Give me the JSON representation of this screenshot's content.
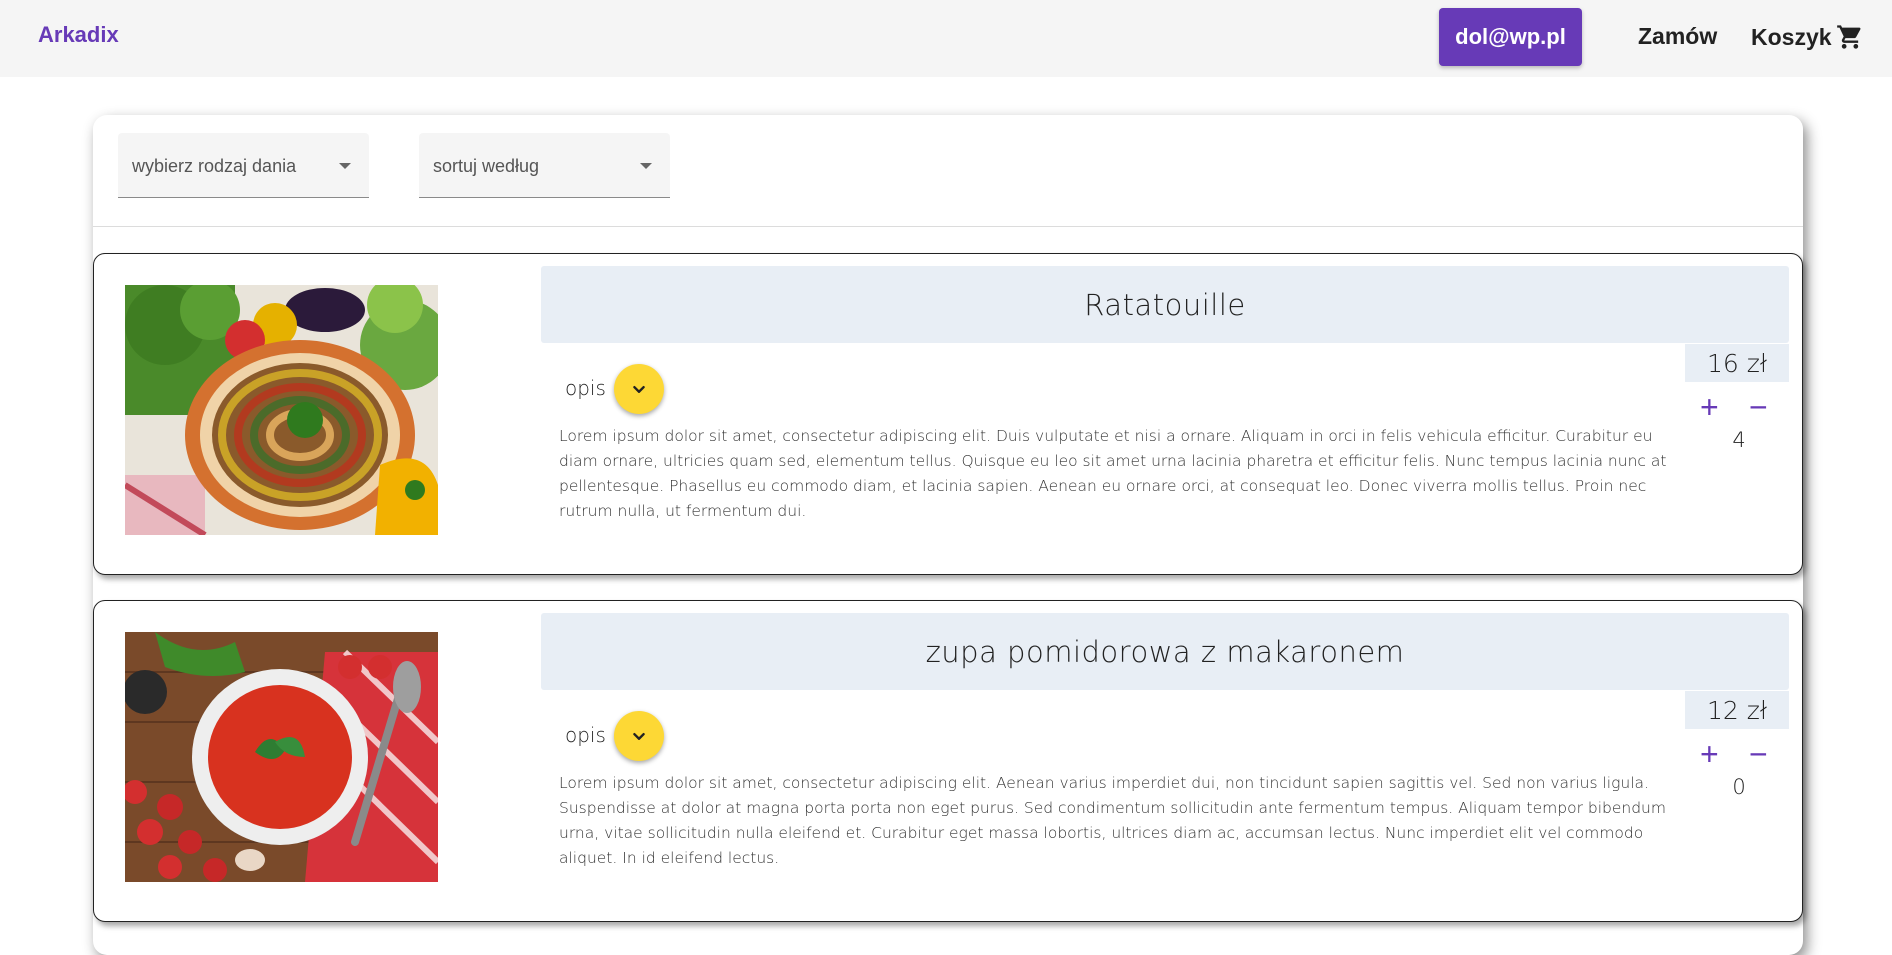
{
  "header": {
    "brand": "Arkadix",
    "user_email": "dol@wp.pl",
    "order_label": "Zamów",
    "cart_label": "Koszyk",
    "accent_color": "#673ab7"
  },
  "filters": {
    "dish_type_label": "wybierz rodzaj dania",
    "sort_label": "sortuj według"
  },
  "dishes": [
    {
      "title": "Ratatouille",
      "price": "16 zł",
      "quantity": "4",
      "opis_label": "opis",
      "description": "Lorem ipsum dolor sit amet, consectetur adipiscing elit. Duis vulputate et nisi a ornare. Aliquam in orci in felis vehicula efficitur. Curabitur eu diam ornare, ultricies quam sed, elementum tellus. Quisque eu leo sit amet urna lacinia pharetra et efficitur felis. Nunc tempus lacinia nunc at pellentesque. Phasellus eu commodo diam, et lacinia sapien. Aenean eu ornare orci, at consequat leo. Donec viverra mollis tellus. Proin nec rutrum nulla, ut fermentum dui.",
      "plus_symbol": "+",
      "minus_symbol": "−"
    },
    {
      "title": "zupa pomidorowa z makaronem",
      "price": "12 zł",
      "quantity": "0",
      "opis_label": "opis",
      "description": "Lorem ipsum dolor sit amet, consectetur adipiscing elit. Aenean varius imperdiet dui, non tincidunt sapien sagittis vel. Sed non varius ligula. Suspendisse at dolor at magna porta porta non eget purus. Sed condimentum sollicitudin ante fermentum tempus. Aliquam tempor bibendum urna, vitae sollicitudin nulla eleifend et. Curabitur eget massa lobortis, ultrices diam ac, accumsan lectus. Nunc imperdiet elit vel commodo aliquet. In id eleifend lectus.",
      "plus_symbol": "+",
      "minus_symbol": "−"
    }
  ],
  "icons": {
    "cart": "shopping-cart-icon",
    "dropdown": "caret-down-icon",
    "expand": "chevron-down-icon"
  }
}
